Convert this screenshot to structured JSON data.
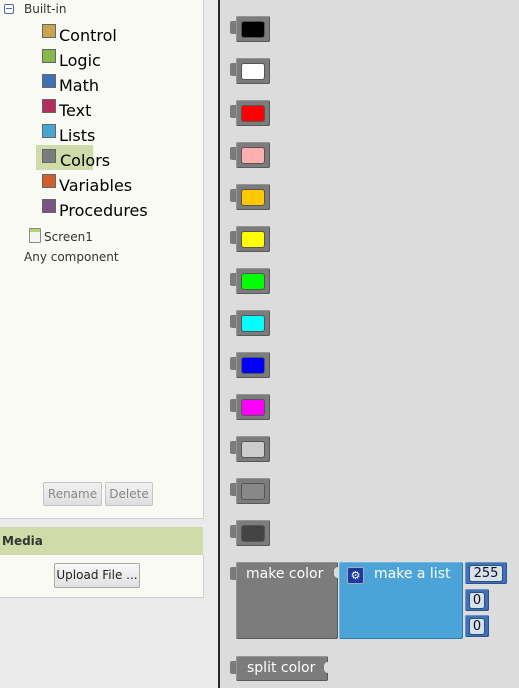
{
  "blocks_panel": {
    "root_label": "Built-in",
    "categories": [
      {
        "label": "Control",
        "color": "#c8a350"
      },
      {
        "label": "Logic",
        "color": "#86b84a"
      },
      {
        "label": "Math",
        "color": "#3f71b5"
      },
      {
        "label": "Text",
        "color": "#b32d5e"
      },
      {
        "label": "Lists",
        "color": "#49a6d4"
      },
      {
        "label": "Colors",
        "color": "#7c7c7c"
      },
      {
        "label": "Variables",
        "color": "#d05f2d"
      },
      {
        "label": "Procedures",
        "color": "#7c5385"
      }
    ],
    "selected_category": "Colors",
    "screen_label": "Screen1",
    "any_component_label": "Any component",
    "rename_label": "Rename",
    "delete_label": "Delete"
  },
  "media": {
    "header": "Media",
    "upload_label": "Upload File ..."
  },
  "workspace": {
    "color_blocks": [
      {
        "name": "black",
        "color": "#000000"
      },
      {
        "name": "white",
        "color": "#ffffff"
      },
      {
        "name": "red",
        "color": "#ff0000"
      },
      {
        "name": "pink",
        "color": "#ffafaf"
      },
      {
        "name": "orange",
        "color": "#ffc800"
      },
      {
        "name": "yellow",
        "color": "#ffff00"
      },
      {
        "name": "green",
        "color": "#00ff00"
      },
      {
        "name": "cyan",
        "color": "#00ffff"
      },
      {
        "name": "blue",
        "color": "#0000ff"
      },
      {
        "name": "magenta",
        "color": "#ff00ff"
      },
      {
        "name": "light-gray",
        "color": "#cccccc"
      },
      {
        "name": "gray",
        "color": "#888888"
      },
      {
        "name": "dark-gray",
        "color": "#444444"
      }
    ],
    "make_color_label": "make color",
    "make_list_label": "make a list",
    "make_list_values": [
      "255",
      "0",
      "0"
    ],
    "split_color_label": "split color"
  }
}
